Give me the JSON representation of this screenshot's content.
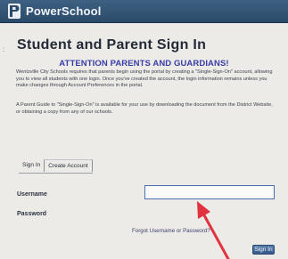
{
  "header": {
    "brand": "PowerSchool",
    "logo_icon": "powerschool-logo-icon",
    "color": "#33557a"
  },
  "page": {
    "title": "Student and Parent Sign In",
    "margin_mark": ":",
    "attention_heading": "ATTENTION PARENTS AND GUARDIANS!",
    "intro_text": "Wentzville City Schools requires that parents begin using the portal by creating a \"Single-Sign-On\" account, allowing you to view all students with one login. Once you've created the account, the login information remains unless you make changes through Account Preferences in the portal.",
    "guide_text": "A Parent Guide to \"Single-Sign-On\" is available for your use by downloading the document from the District Website, or obtaining a copy from any of our schools."
  },
  "tabs": [
    {
      "label": "Sign In"
    },
    {
      "label": "Create Account"
    }
  ],
  "form": {
    "username_label": "Username",
    "username_value": "",
    "password_label": "Password",
    "forgot_link": "Forgot Username or Password?",
    "signin_button": "Sign In"
  },
  "annotation": {
    "arrow_color": "#e0323f",
    "arrow_icon": "red-arrow-icon"
  }
}
